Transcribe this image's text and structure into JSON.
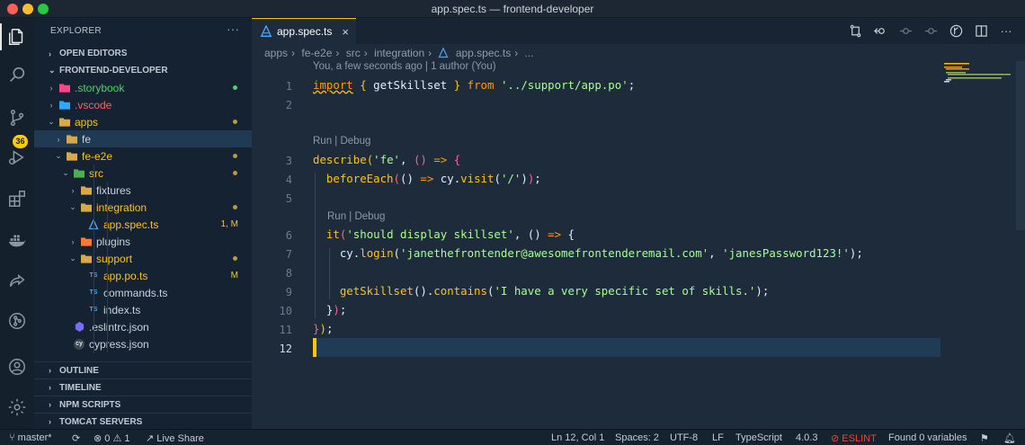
{
  "window": {
    "title": "app.spec.ts — frontend-developer"
  },
  "colors": {
    "accent": "#ffc600",
    "close": "#ff5f57",
    "minimize": "#febc2e",
    "maximize": "#28c840",
    "eslint_error": "#ff3b3b"
  },
  "activity": {
    "icons": [
      "files-icon",
      "search-icon",
      "source-control-icon",
      "run-debug-icon",
      "extensions-icon",
      "docker-icon",
      "live-share-icon",
      "git-icon",
      "account-icon",
      "settings-gear-icon"
    ],
    "scm_badge": "36"
  },
  "sidebar": {
    "header": "EXPLORER",
    "menu": "···",
    "open_editors": "OPEN EDITORS",
    "folder": "FRONTEND-DEVELOPER",
    "tree": [
      {
        "label": ".storybook",
        "icon": "folder-icon",
        "color": "#4fd16a"
      },
      {
        "label": ".vscode",
        "icon": "folder-icon",
        "color": "#ff5f6d"
      },
      {
        "label": "apps",
        "icon": "folder-icon",
        "color": "#ffc600"
      },
      {
        "label": "fe",
        "icon": "folder-icon",
        "color": "#c9d4de"
      },
      {
        "label": "fe-e2e",
        "icon": "folder-icon",
        "color": "#ffc600"
      },
      {
        "label": "src",
        "icon": "folder-icon",
        "color": "#ffc600"
      },
      {
        "label": "fixtures",
        "icon": "folder-icon",
        "color": "#c9d4de"
      },
      {
        "label": "integration",
        "icon": "folder-icon",
        "color": "#ffc600"
      },
      {
        "label": "app.spec.ts",
        "icon": "test-file-icon",
        "color": "#ffc600",
        "mark": "1, M"
      },
      {
        "label": "plugins",
        "icon": "folder-icon",
        "color": "#c9d4de"
      },
      {
        "label": "support",
        "icon": "folder-icon",
        "color": "#ffc600"
      },
      {
        "label": "app.po.ts",
        "icon": "typescript-file-icon",
        "color": "#ffc600",
        "mark": "M"
      },
      {
        "label": "commands.ts",
        "icon": "typescript-file-icon",
        "color": "#c9d4de"
      },
      {
        "label": "index.ts",
        "icon": "typescript-file-icon",
        "color": "#c9d4de"
      },
      {
        "label": ".eslintrc.json",
        "icon": "eslint-file-icon",
        "color": "#c9d4de"
      },
      {
        "label": "cypress.json",
        "icon": "cypress-file-icon",
        "color": "#c9d4de"
      }
    ],
    "ts_icon_label": "TS",
    "cy_icon_label": "cy",
    "panels": [
      "OUTLINE",
      "TIMELINE",
      "NPM SCRIPTS",
      "TOMCAT SERVERS"
    ]
  },
  "editor": {
    "tab": {
      "label": "app.spec.ts",
      "close": "×"
    },
    "breadcrumb": [
      "apps",
      "fe-e2e",
      "src",
      "integration",
      "app.spec.ts",
      "..."
    ],
    "breadcrumb_sep": "›",
    "blame": "You, a few seconds ago | 1 author (You)",
    "codelens": "Run | Debug",
    "line_numbers": [
      "1",
      "2",
      "3",
      "4",
      "5",
      "6",
      "7",
      "8",
      "9",
      "10",
      "11",
      "12"
    ],
    "lines": {
      "l1": [
        "import",
        "{",
        "getSkillset",
        "}",
        "from",
        "'../support/app.po'",
        ";"
      ],
      "l3": [
        "describe",
        "(",
        "'fe'",
        ",",
        "()",
        "=>",
        "{"
      ],
      "l4": [
        "beforeEach",
        "(",
        "()",
        "=>",
        "cy",
        ".",
        "visit",
        "(",
        "'/'",
        ")",
        ")",
        ";"
      ],
      "l6": [
        "it",
        "(",
        "'should display skillset'",
        ",",
        "()",
        "=>",
        "{"
      ],
      "l7": [
        "cy",
        ".",
        "login",
        "(",
        "'janethefrontender@awesomefrontenderemail.com'",
        ",",
        "'janesPassword123!'",
        ")",
        ";"
      ],
      "l9": [
        "getSkillset",
        "()",
        ".",
        "contains",
        "(",
        "'I have a very specific set of skills.'",
        ")",
        ";"
      ],
      "l10": [
        "}",
        ")",
        ";"
      ],
      "l11": [
        "}",
        ")",
        ";"
      ]
    }
  },
  "toolbar_icons": [
    "open-changes-icon",
    "go-back-icon",
    "go-prev-change-icon",
    "go-next-change-icon",
    "gitlens-icon",
    "split-editor-icon",
    "more-actions-icon"
  ],
  "toolbar_more": "···",
  "status": {
    "branch": "master*",
    "sync": "⟳",
    "problems": "⊗ 0 ⚠ 1",
    "live_share": "Live Share",
    "position": "Ln 12, Col 1",
    "spaces": "Spaces: 2",
    "encoding": "UTF-8",
    "eol": "LF",
    "language": "TypeScript",
    "version": "4.0.3",
    "eslint": "⊘ ESLINT",
    "variables": "Found 0 variables"
  }
}
